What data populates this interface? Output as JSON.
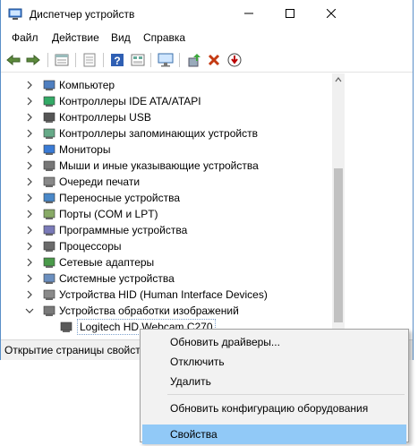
{
  "window": {
    "title": "Диспетчер устройств"
  },
  "menu": [
    "Файл",
    "Действие",
    "Вид",
    "Справка"
  ],
  "toolbar": [
    "back-arrow-icon",
    "forward-arrow-icon",
    "properties-icon",
    "list-icon",
    "help-icon",
    "view-icon",
    "monitor-icon",
    "update-driver-icon",
    "delete-icon",
    "download-icon"
  ],
  "tree": [
    {
      "label": "Компьютер",
      "icon": "computer-icon"
    },
    {
      "label": "Контроллеры IDE ATA/ATAPI",
      "icon": "ide-controller-icon"
    },
    {
      "label": "Контроллеры USB",
      "icon": "usb-icon"
    },
    {
      "label": "Контроллеры запоминающих устройств",
      "icon": "storage-controller-icon"
    },
    {
      "label": "Мониторы",
      "icon": "monitor-icon"
    },
    {
      "label": "Мыши и иные указывающие устройства",
      "icon": "mouse-icon"
    },
    {
      "label": "Очереди печати",
      "icon": "printer-icon"
    },
    {
      "label": "Переносные устройства",
      "icon": "portable-device-icon"
    },
    {
      "label": "Порты (COM и LPT)",
      "icon": "port-icon"
    },
    {
      "label": "Программные устройства",
      "icon": "software-device-icon"
    },
    {
      "label": "Процессоры",
      "icon": "processor-icon"
    },
    {
      "label": "Сетевые адаптеры",
      "icon": "network-adapter-icon"
    },
    {
      "label": "Системные устройства",
      "icon": "system-device-icon"
    },
    {
      "label": "Устройства HID (Human Interface Devices)",
      "icon": "hid-icon"
    },
    {
      "label": "Устройства обработки изображений",
      "icon": "imaging-device-icon",
      "expanded": true
    },
    {
      "label": "Logitech HD Webcam C270",
      "icon": "webcam-icon",
      "child": true
    }
  ],
  "status": "Открытие страницы свойств",
  "context_menu": {
    "items": [
      {
        "label": "Обновить драйверы..."
      },
      {
        "label": "Отключить"
      },
      {
        "label": "Удалить"
      },
      {
        "label": "Обновить конфигурацию оборудования"
      },
      {
        "label": "Свойства",
        "highlighted": true
      }
    ]
  },
  "colors": {
    "accent": "#5a8fc8",
    "highlight": "#91c9f7"
  }
}
